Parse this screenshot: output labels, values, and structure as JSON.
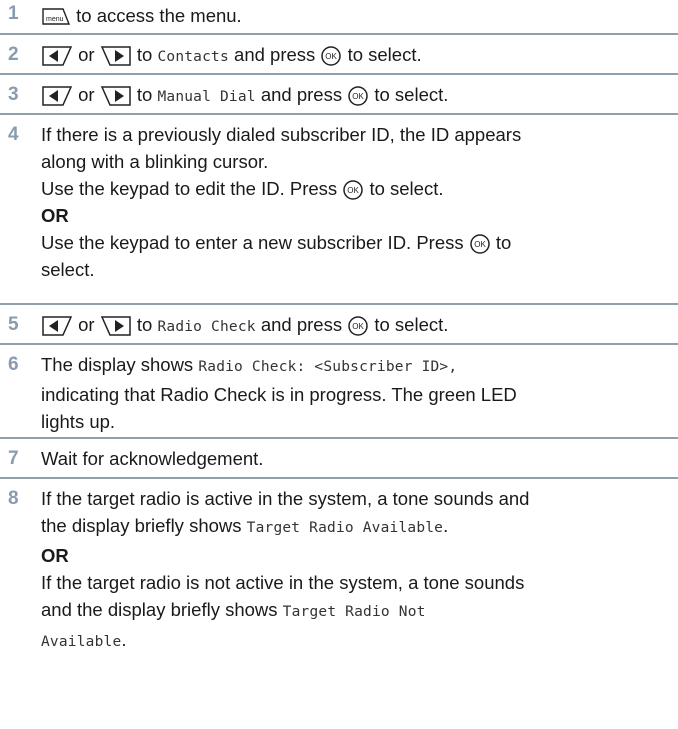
{
  "steps": [
    {
      "num": "1",
      "text": "to access the menu."
    },
    {
      "num": "2",
      "or": "or",
      "to": "to",
      "target": "Contacts",
      "and": "and press",
      "select": "to select."
    },
    {
      "num": "3",
      "or": "or",
      "to": "to",
      "target": "Manual Dial",
      "and": "and press",
      "select": "to select."
    },
    {
      "num": "4",
      "l1": "If there is a previously dialed subscriber ID, the ID appears",
      "l2": "along with a blinking cursor.",
      "l3a": "Use the keypad to edit the ID. Press",
      "l3b": "to select.",
      "or": "OR",
      "l4a": "Use the keypad to enter a new subscriber ID. Press",
      "l4b": "to",
      "l5": "select."
    },
    {
      "num": "5",
      "or": "or",
      "to": "to",
      "target": "Radio Check",
      "and": "and press",
      "select": "to select."
    },
    {
      "num": "6",
      "a": "The display shows",
      "mono": "Radio Check: <Subscriber ID>,",
      "l2": "indicating that Radio Check is in progress. The green LED",
      "l3": "lights up."
    },
    {
      "num": "7",
      "text": "Wait for acknowledgement."
    },
    {
      "num": "8",
      "l1": "If the target radio is active in the system, a tone sounds and",
      "l2a": "the display briefly shows",
      "l2m": "Target Radio Available",
      "l2end": ".",
      "or": "OR",
      "l3": "If the target radio is not active in the system, a tone sounds",
      "l4a": "and the display briefly shows",
      "l4m": "Target Radio Not",
      "l5m": "Available",
      "l5end": "."
    }
  ],
  "icons": {
    "menu": "menu-key-icon",
    "left": "left-nav-key-icon",
    "right": "right-nav-key-icon",
    "ok": "ok-key-icon"
  },
  "icon_labels": {
    "menu": "menu",
    "ok": "OK"
  },
  "colors": {
    "number": "#8a9bb0",
    "divider": "#8fa0ad",
    "text": "#1a1a1a"
  }
}
